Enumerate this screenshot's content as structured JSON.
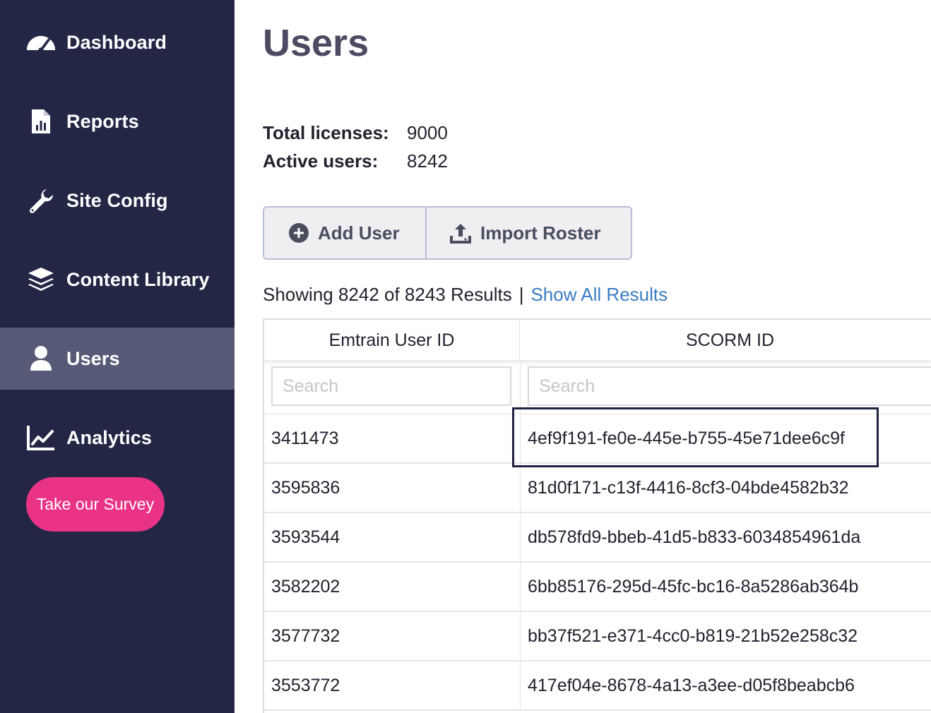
{
  "sidebar": {
    "items": [
      {
        "label": "Dashboard",
        "icon": "dashboard-gauge-icon",
        "active": false
      },
      {
        "label": "Reports",
        "icon": "report-file-icon",
        "active": false
      },
      {
        "label": "Site Config",
        "icon": "wrench-icon",
        "active": false
      },
      {
        "label": "Content Library",
        "icon": "layers-icon",
        "active": false
      },
      {
        "label": "Users",
        "icon": "user-icon",
        "active": true
      },
      {
        "label": "Analytics",
        "icon": "line-chart-icon",
        "active": false
      }
    ],
    "survey_label": "Take our Survey"
  },
  "main": {
    "title": "Users",
    "stats": {
      "total_licenses_label": "Total licenses:",
      "total_licenses_value": "9000",
      "active_users_label": "Active users:",
      "active_users_value": "8242"
    },
    "actions": {
      "add_user_label": "Add User",
      "import_roster_label": "Import Roster"
    },
    "results": {
      "summary": "Showing 8242 of 8243 Results",
      "separator": "|",
      "show_all_label": "Show All Results"
    },
    "table": {
      "columns": [
        "Emtrain User ID",
        "SCORM ID"
      ],
      "search_placeholders": [
        "Search",
        "Search"
      ],
      "rows": [
        {
          "user_id": "3411473",
          "scorm_id": "4ef9f191-fe0e-445e-b755-45e71dee6c9f"
        },
        {
          "user_id": "3595836",
          "scorm_id": "81d0f171-c13f-4416-8cf3-04bde4582b32"
        },
        {
          "user_id": "3593544",
          "scorm_id": "db578fd9-bbeb-41d5-b833-6034854961da"
        },
        {
          "user_id": "3582202",
          "scorm_id": "6bb85176-295d-45fc-bc16-8a5286ab364b"
        },
        {
          "user_id": "3577732",
          "scorm_id": "bb37f521-e371-4cc0-b819-21b52e258c32"
        },
        {
          "user_id": "3553772",
          "scorm_id": "417ef04e-8678-4a13-a3ee-d05f8beabcb6"
        }
      ]
    }
  },
  "colors": {
    "sidebar_bg": "#232645",
    "sidebar_active_bg": "#565a77",
    "survey_button": "#ea3386",
    "link": "#3a7cc2",
    "title": "#4d4a64"
  }
}
